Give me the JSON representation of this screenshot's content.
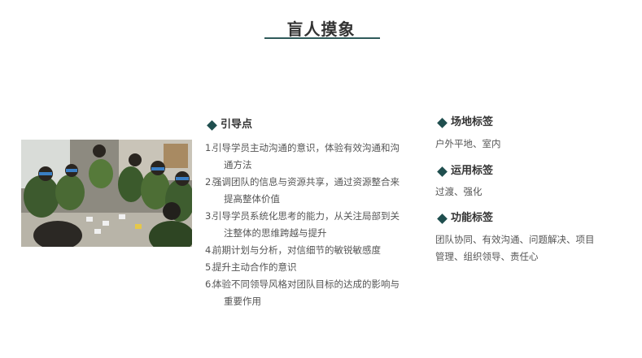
{
  "title": "盲人摸象",
  "guide": {
    "heading": "引导点",
    "items": [
      {
        "num": "1.",
        "text": "引导学员主动沟通的意识，体验有效沟通和沟通方法"
      },
      {
        "num": "2.",
        "text": "强调团队的信息与资源共享，通过资源整合来提高整体价值"
      },
      {
        "num": "3.",
        "text": "引导学员系统化思考的能力，从关注局部到关注整体的思维跨越与提升"
      },
      {
        "num": "4.",
        "text": "前期计划与分析，对信细节的敏锐敏感度"
      },
      {
        "num": "5.",
        "text": "提升主动合作的意识"
      },
      {
        "num": "6.",
        "text": "体验不同领导风格对团队目标的达成的影响与重要作用"
      }
    ]
  },
  "venue": {
    "heading": "场地标签",
    "text": "户外平地、室内"
  },
  "usage": {
    "heading": "运用标签",
    "text": "过渡、强化"
  },
  "function": {
    "heading": "功能标签",
    "line1": "团队协同、有效沟通、问题解决、项目",
    "line2": "管理、组织领导、责任心"
  },
  "colors": {
    "accent": "#1f4e4e",
    "title": "#333333",
    "body": "#555555"
  }
}
